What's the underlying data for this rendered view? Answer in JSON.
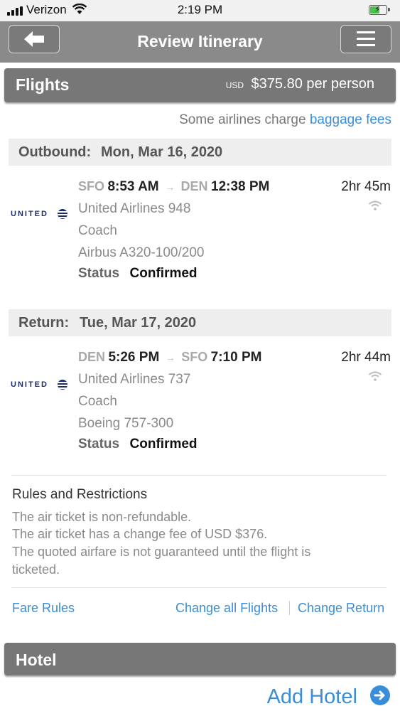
{
  "status_bar": {
    "carrier": "Verizon",
    "time": "2:19 PM"
  },
  "nav": {
    "title": "Review Itinerary",
    "back_icon": "arrow-left-icon",
    "menu_icon": "hamburger-menu-icon"
  },
  "flights": {
    "title": "Flights",
    "currency": "USD",
    "price": "$375.80 per person",
    "baggage_prefix": "Some airlines charge",
    "baggage_link": "baggage fees",
    "outbound": {
      "label": "Outbound:",
      "date": "Mon, Mar 16, 2020",
      "airline_logo": "UNITED",
      "from_code": "SFO",
      "from_time": "8:53 AM",
      "to_code": "DEN",
      "to_time": "12:38 PM",
      "duration": "2hr 45m",
      "flight": "United Airlines 948",
      "cabin": "Coach",
      "aircraft": "Airbus A320-100/200",
      "status_label": "Status",
      "status": "Confirmed"
    },
    "return": {
      "label": "Return:",
      "date": "Tue, Mar 17, 2020",
      "airline_logo": "UNITED",
      "from_code": "DEN",
      "from_time": "5:26 PM",
      "to_code": "SFO",
      "to_time": "7:10 PM",
      "duration": "2hr 44m",
      "flight": "United Airlines 737",
      "cabin": "Coach",
      "aircraft": "Boeing 757-300",
      "status_label": "Status",
      "status": "Confirmed"
    },
    "rules": {
      "title": "Rules and Restrictions",
      "line1": "The air ticket is non-refundable.",
      "line2": "The air ticket has a change fee of USD $376.",
      "line3a": "The quoted airfare is not guaranteed until the flight is",
      "line3b": "ticketed."
    },
    "links": {
      "fare_rules": "Fare Rules",
      "change_all": "Change all Flights",
      "change_return": "Change Return"
    }
  },
  "hotel": {
    "title": "Hotel",
    "add_label": "Add Hotel"
  }
}
